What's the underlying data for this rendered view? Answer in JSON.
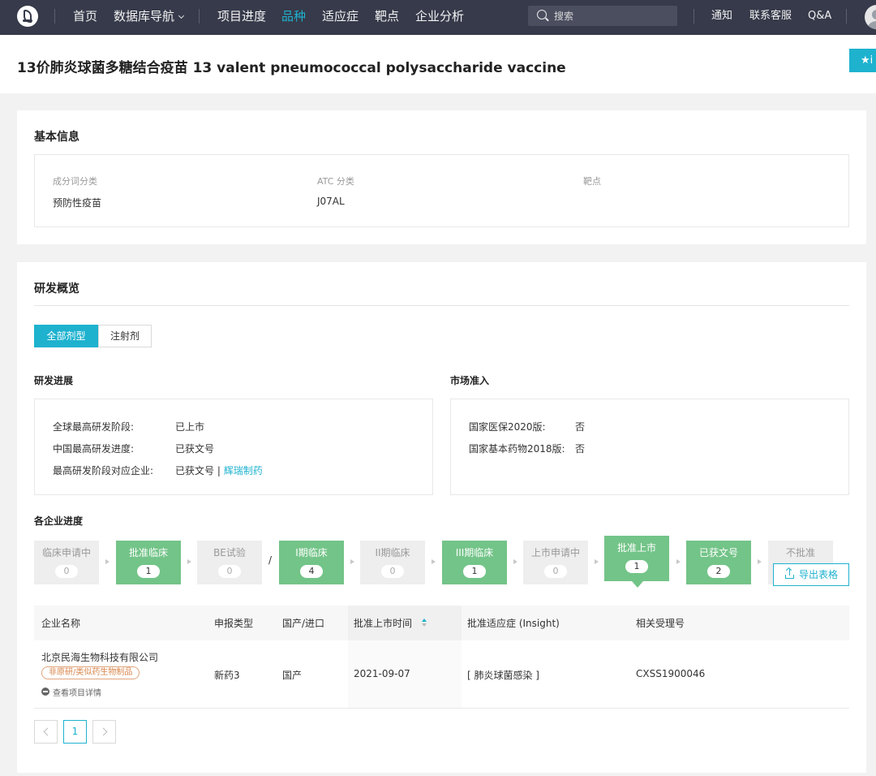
{
  "nav": {
    "items": [
      "首页",
      "数据库导航",
      "项目进度",
      "品种",
      "适应症",
      "靶点",
      "企业分析"
    ],
    "active": "品种",
    "search_placeholder": "搜索",
    "right_items": [
      "通知",
      "联系客服",
      "Q&A"
    ],
    "accent_color": "#1eb2cf",
    "bg_color": "#363a4a"
  },
  "title": {
    "text": "13价肺炎球菌多糖结合疫苗 13 valent pneumococcal polysaccharide vaccine",
    "fav_button": "★i"
  },
  "basic_info": {
    "heading": "基本信息",
    "fields": [
      {
        "label": "成分词分类",
        "value": "预防性疫苗"
      },
      {
        "label": "ATC 分类",
        "value": "J07AL"
      },
      {
        "label": "靶点",
        "value": ""
      }
    ]
  },
  "rd_overview": {
    "heading": "研发概览",
    "tabs": [
      "全部剂型",
      "注射剂"
    ],
    "active_tab": "全部剂型",
    "progress": {
      "heading": "研发进展",
      "rows": [
        {
          "label": "全球最高研发阶段:",
          "value": "已上市"
        },
        {
          "label": "中国最高研发进度:",
          "value": "已获文号"
        },
        {
          "label": "最高研发阶段对应企业:",
          "value": "已获文号",
          "separator": " | ",
          "link": "辉瑞制药"
        }
      ]
    },
    "market": {
      "heading": "市场准入",
      "rows": [
        {
          "label": "国家医保2020版:",
          "value": "否"
        },
        {
          "label": "国家基本药物2018版:",
          "value": "否"
        }
      ]
    },
    "company_progress": {
      "heading": "各企业进度",
      "slash": "/",
      "stages": [
        {
          "label": "临床申请中",
          "count": "0",
          "active": false
        },
        {
          "label": "批准临床",
          "count": "1",
          "active": true
        },
        {
          "label": "BE试验",
          "count": "0",
          "active": false
        },
        {
          "label": "I期临床",
          "count": "4",
          "active": true
        },
        {
          "label": "II期临床",
          "count": "0",
          "active": false
        },
        {
          "label": "III期临床",
          "count": "1",
          "active": true
        },
        {
          "label": "上市申请中",
          "count": "0",
          "active": false
        },
        {
          "label": "批准上市",
          "count": "1",
          "active": true,
          "selected": true
        },
        {
          "label": "已获文号",
          "count": "2",
          "active": true
        },
        {
          "label": "不批准",
          "count": "",
          "active": false
        }
      ],
      "export_button": "导出表格"
    },
    "table": {
      "columns": [
        "企业名称",
        "申报类型",
        "国产/进口",
        "批准上市时间",
        "批准适应症 (Insight)",
        "相关受理号"
      ],
      "rows": [
        {
          "company": "北京民海生物科技有限公司",
          "tag": "非原研/类似药生物制品",
          "detail": "查看项目详情",
          "type": "新药3",
          "origin": "国产",
          "date": "2021-09-07",
          "indication": "[ 肺炎球菌感染 ]",
          "accept_no": "CXSS1900046"
        }
      ]
    },
    "pagination": {
      "current": "1"
    }
  }
}
